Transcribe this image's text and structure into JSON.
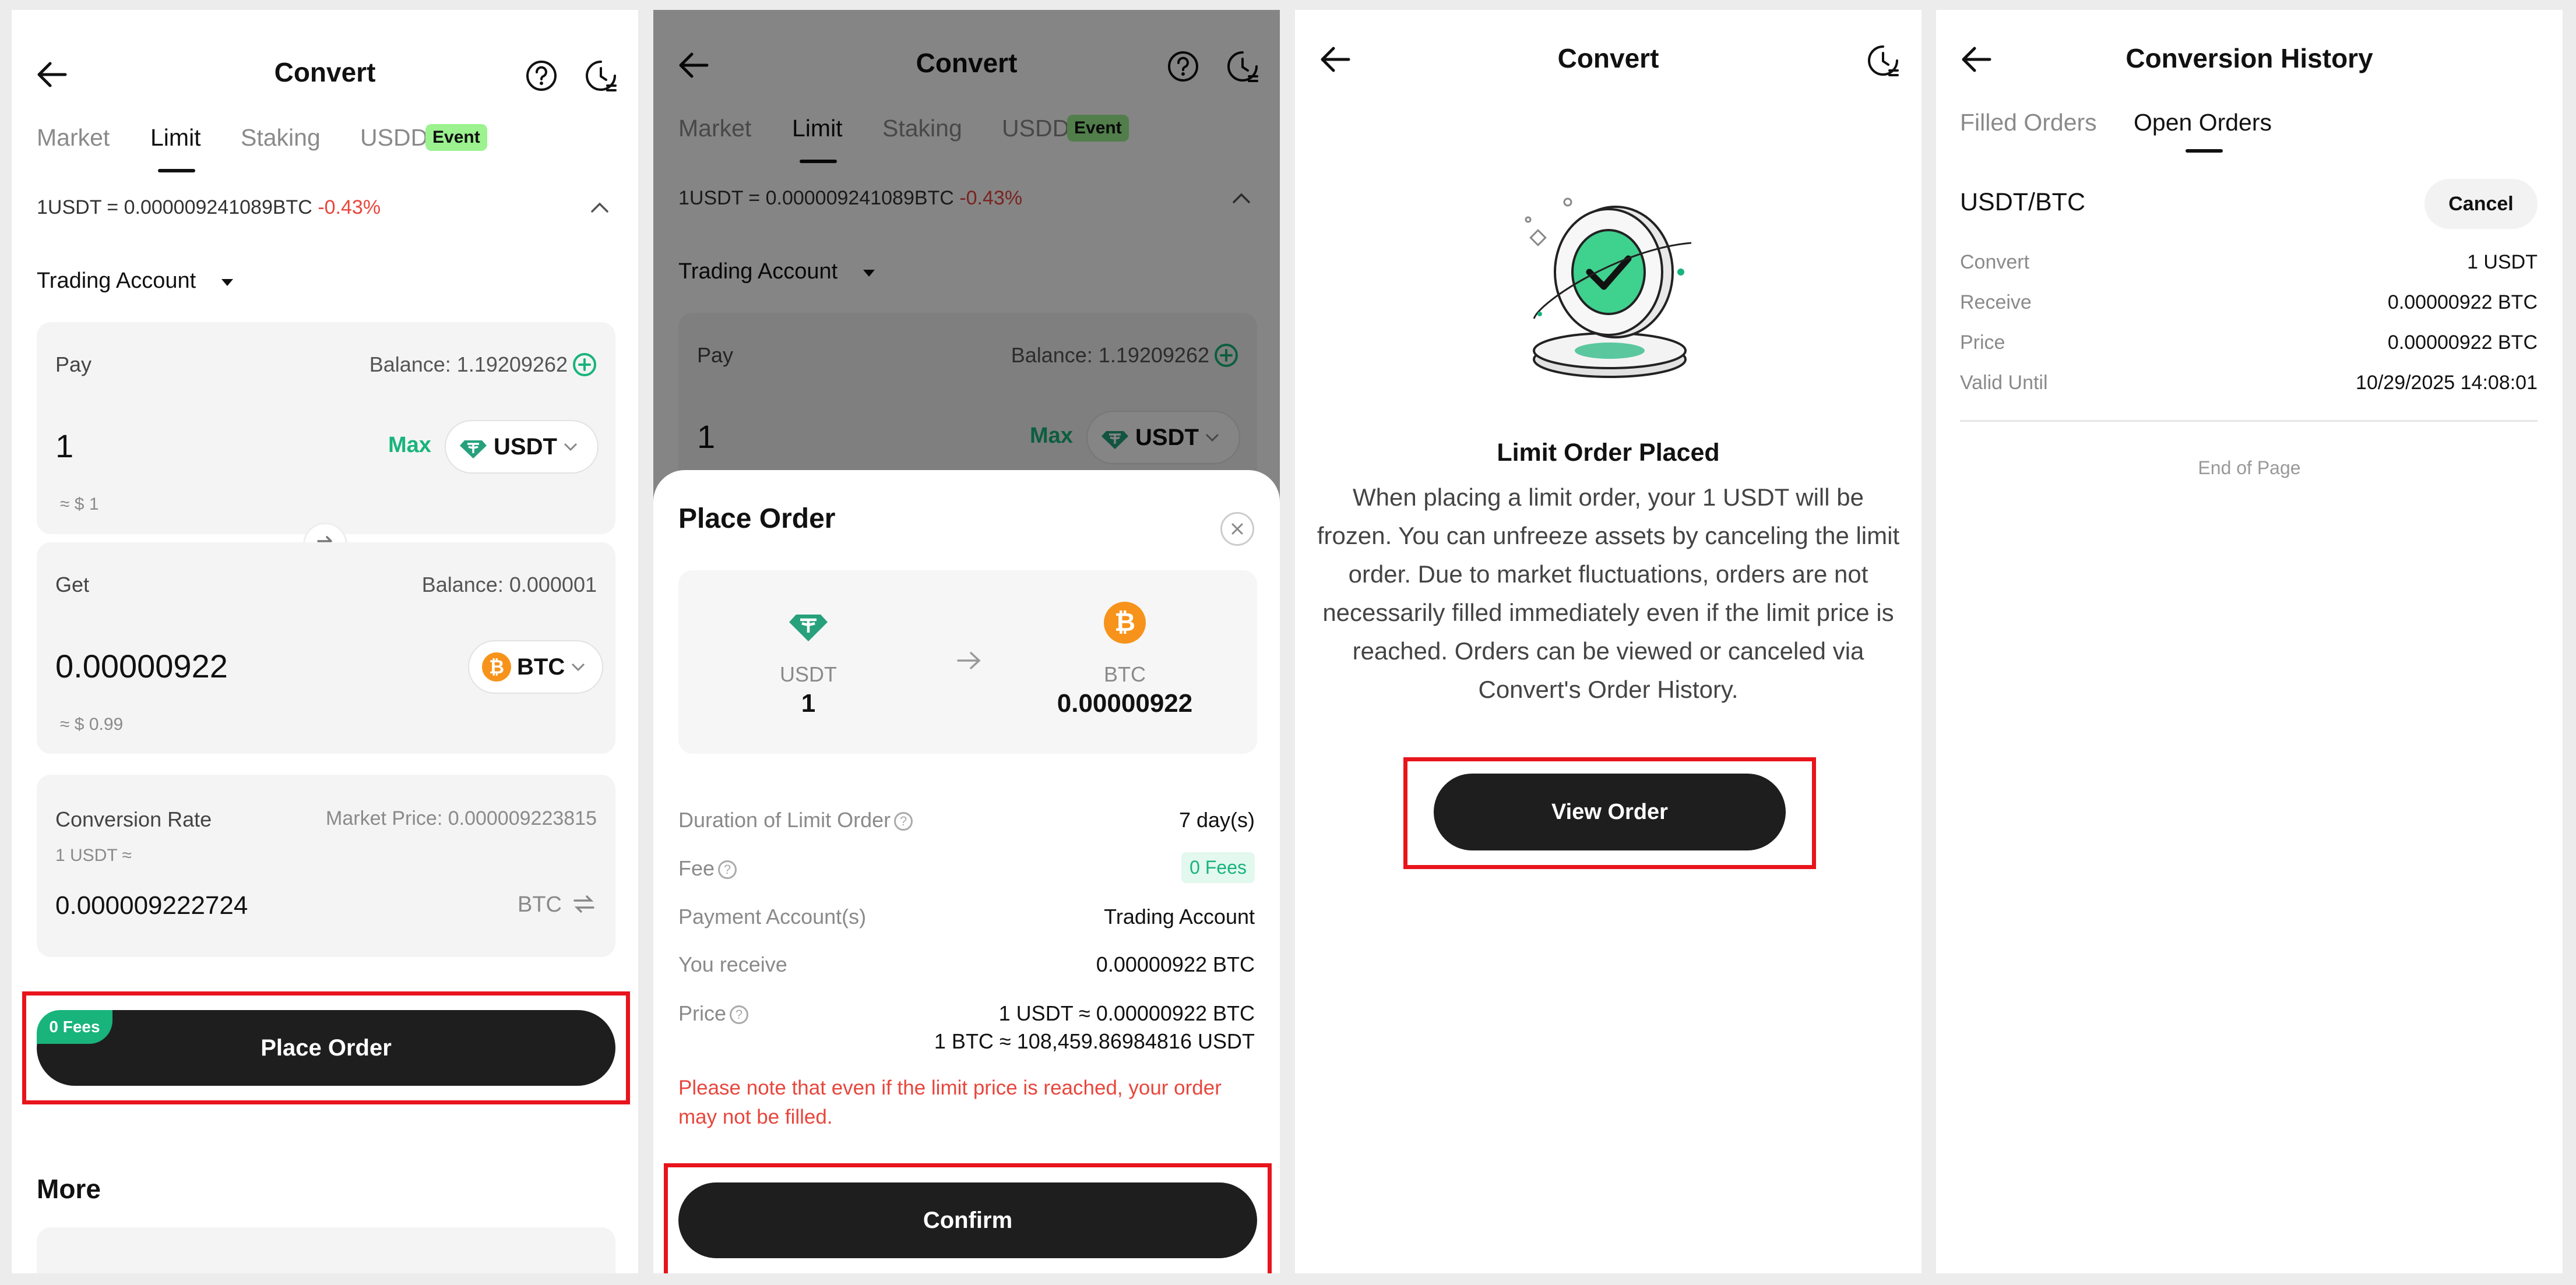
{
  "p1": {
    "title": "Convert",
    "tabs": [
      "Market",
      "Limit",
      "Staking",
      "USDD"
    ],
    "event_badge": "Event",
    "rate_text": "1USDT = 0.000009241089BTC",
    "rate_change": "-0.43%",
    "account": "Trading Account",
    "pay": {
      "label": "Pay",
      "balance": "Balance: 1.19209262",
      "amount": "1",
      "max": "Max",
      "coin": "USDT",
      "usd": "≈ $ 1"
    },
    "get": {
      "label": "Get",
      "balance": "Balance: 0.000001",
      "amount": "0.00000922",
      "coin": "BTC",
      "usd": "≈ $ 0.99"
    },
    "conv": {
      "label": "Conversion Rate",
      "market": "Market Price: 0.000009223815",
      "sub": "1 USDT ≈",
      "value": "0.000009222724",
      "unit": "BTC"
    },
    "fees_badge": "0 Fees",
    "place_order": "Place Order",
    "more": "More"
  },
  "p2": {
    "title": "Convert",
    "tabs": [
      "Market",
      "Limit",
      "Staking",
      "USDD"
    ],
    "event_badge": "Event",
    "rate_text": "1USDT = 0.000009241089BTC",
    "rate_change": "-0.43%",
    "account": "Trading Account",
    "pay_label": "Pay",
    "pay_balance": "Balance: 1.19209262",
    "pay_amount": "1",
    "max": "Max",
    "coin": "USDT",
    "sheet": {
      "title": "Place Order",
      "from_coin": "USDT",
      "from_amount": "1",
      "to_coin": "BTC",
      "to_amount": "0.00000922",
      "duration_label": "Duration of Limit Order",
      "duration_value": "7 day(s)",
      "fee_label": "Fee",
      "fee_value": "0 Fees",
      "payacc_label": "Payment Account(s)",
      "payacc_value": "Trading Account",
      "receive_label": "You receive",
      "receive_value": "0.00000922 BTC",
      "price_label": "Price",
      "price_value1": "1 USDT ≈ 0.00000922 BTC",
      "price_value2": "1 BTC ≈ 108,459.86984816 USDT",
      "warning": "Please note that even if the limit price is reached, your order may not be filled.",
      "confirm": "Confirm"
    }
  },
  "p3": {
    "title": "Convert",
    "placed_title": "Limit Order Placed",
    "placed_text": "When placing a limit order, your 1 USDT will be frozen. You can unfreeze assets by canceling the limit order. Due to market fluctuations, orders are not necessarily filled immediately even if the limit price is reached. Orders can be viewed or canceled via Convert's Order History.",
    "view_order": "View Order"
  },
  "p4": {
    "title": "Conversion History",
    "tabs": [
      "Filled Orders",
      "Open Orders"
    ],
    "pair": "USDT/BTC",
    "cancel": "Cancel",
    "rows": [
      {
        "label": "Convert",
        "value": "1 USDT"
      },
      {
        "label": "Receive",
        "value": "0.00000922 BTC"
      },
      {
        "label": "Price",
        "value": "0.00000922 BTC"
      },
      {
        "label": "Valid Until",
        "value": "10/29/2025 14:08:01"
      }
    ],
    "end": "End of Page"
  },
  "colors": {
    "accent_green": "#18b47b",
    "negative": "#e8463c",
    "event_bg": "#9bf28f",
    "btc_orange": "#f7931a",
    "highlight_red": "#e8141c"
  },
  "icons": [
    "back-arrow-icon",
    "help-icon",
    "history-icon",
    "chevron-up-icon",
    "caret-down-icon",
    "plus-circle-icon",
    "usdt-icon",
    "btc-icon",
    "swap-icon",
    "close-icon",
    "arrow-right-icon",
    "success-check-icon"
  ]
}
